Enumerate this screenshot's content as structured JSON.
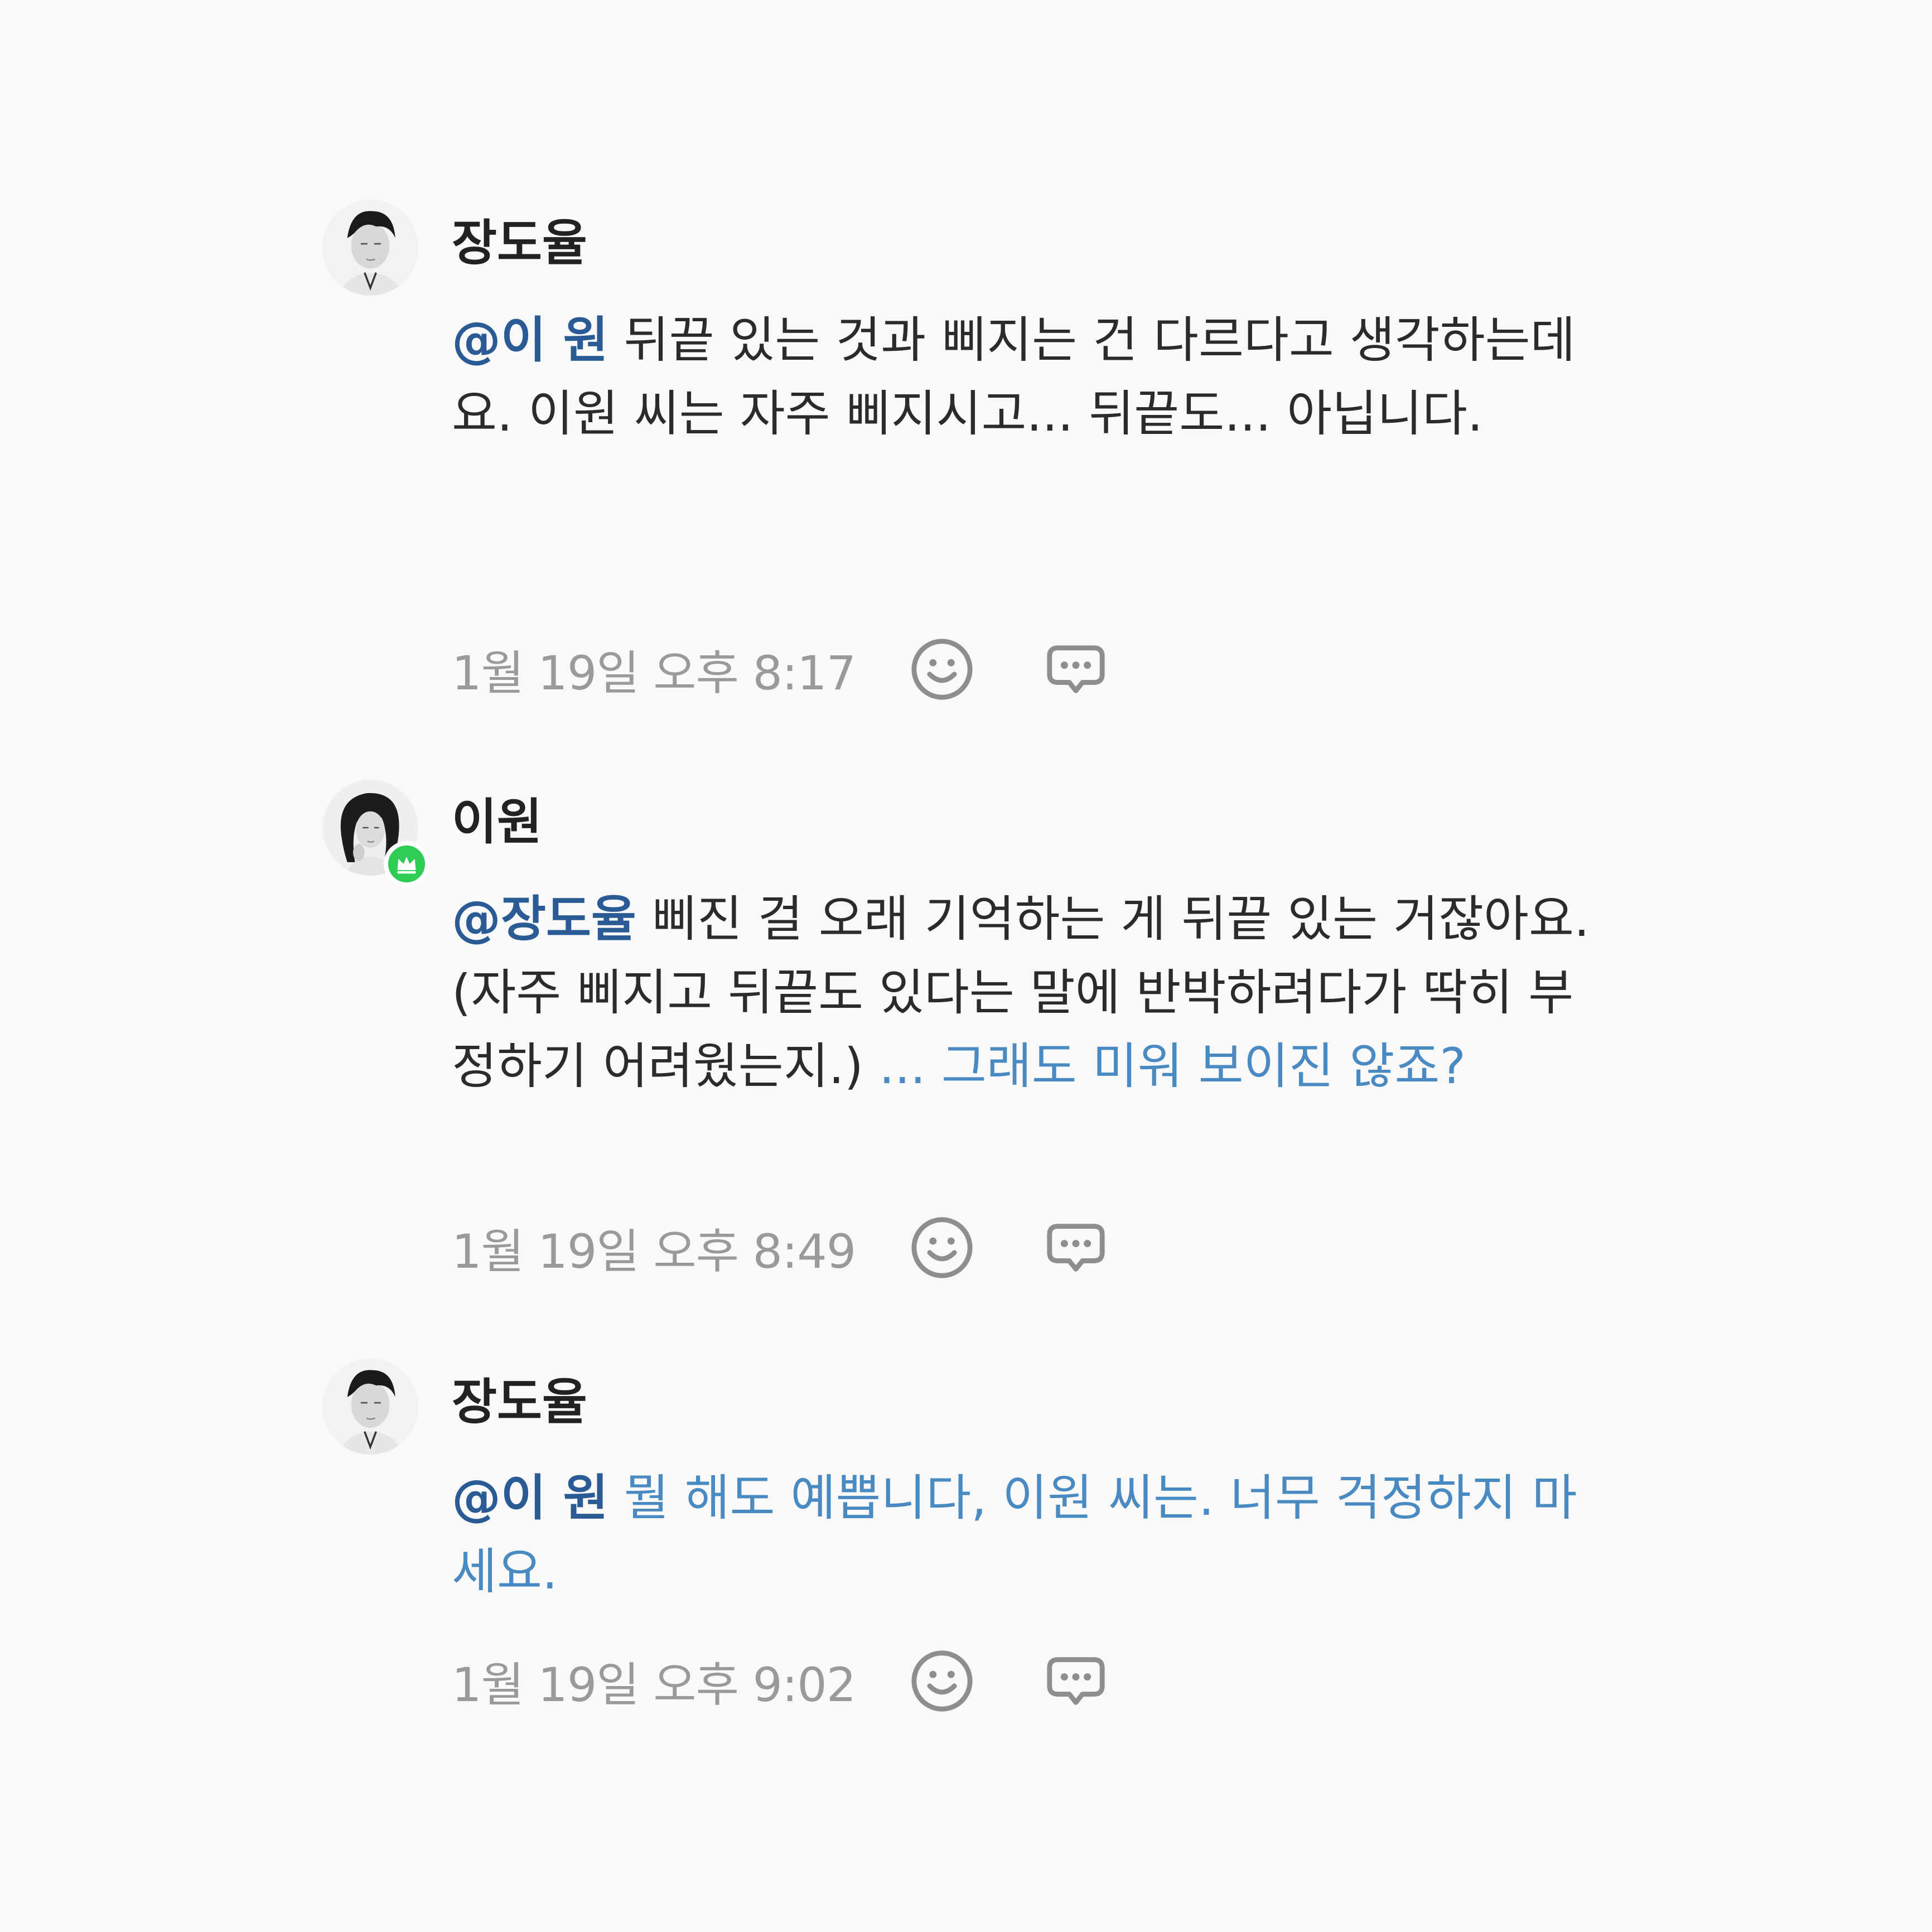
{
  "comments": [
    {
      "author": "장도율",
      "mention": "@이 원",
      "text": " 뒤끝 있는 것과 삐지는 건 다르다고 생각하는데요. 이원 씨는 자주 삐지시고... 뒤끝도... 아닙니다.",
      "action": "",
      "timestamp": "1월 19일 오후 8:17"
    },
    {
      "author": "이원",
      "mention": "@장도율",
      "text": " 삐진 걸 오래 기억하는 게 뒤끝 있는 거잖아요. (자주 삐지고 뒤끝도 있다는 말에 반박하려다가 딱히 부정하기 어려웠는지.) ",
      "action": "... 그래도 미워 보이진 않죠?",
      "timestamp": "1월 19일 오후 8:49"
    },
    {
      "author": "장도율",
      "mention": "@이 원",
      "text": " ",
      "action": "뭘 해도 예쁩니다, 이원 씨는. 너무 걱정하지 마세요.",
      "timestamp": "1월 19일 오후 9:02"
    }
  ],
  "icons": {
    "reaction": "smiley-icon",
    "reply": "speech-bubble-dots-icon",
    "badge": "crown-icon"
  },
  "colors": {
    "background": "#f9f9f9",
    "mention": "#2a5b95",
    "action": "#4a8ac2",
    "timestamp": "#9a9a9a",
    "badge": "#2ecc55"
  }
}
